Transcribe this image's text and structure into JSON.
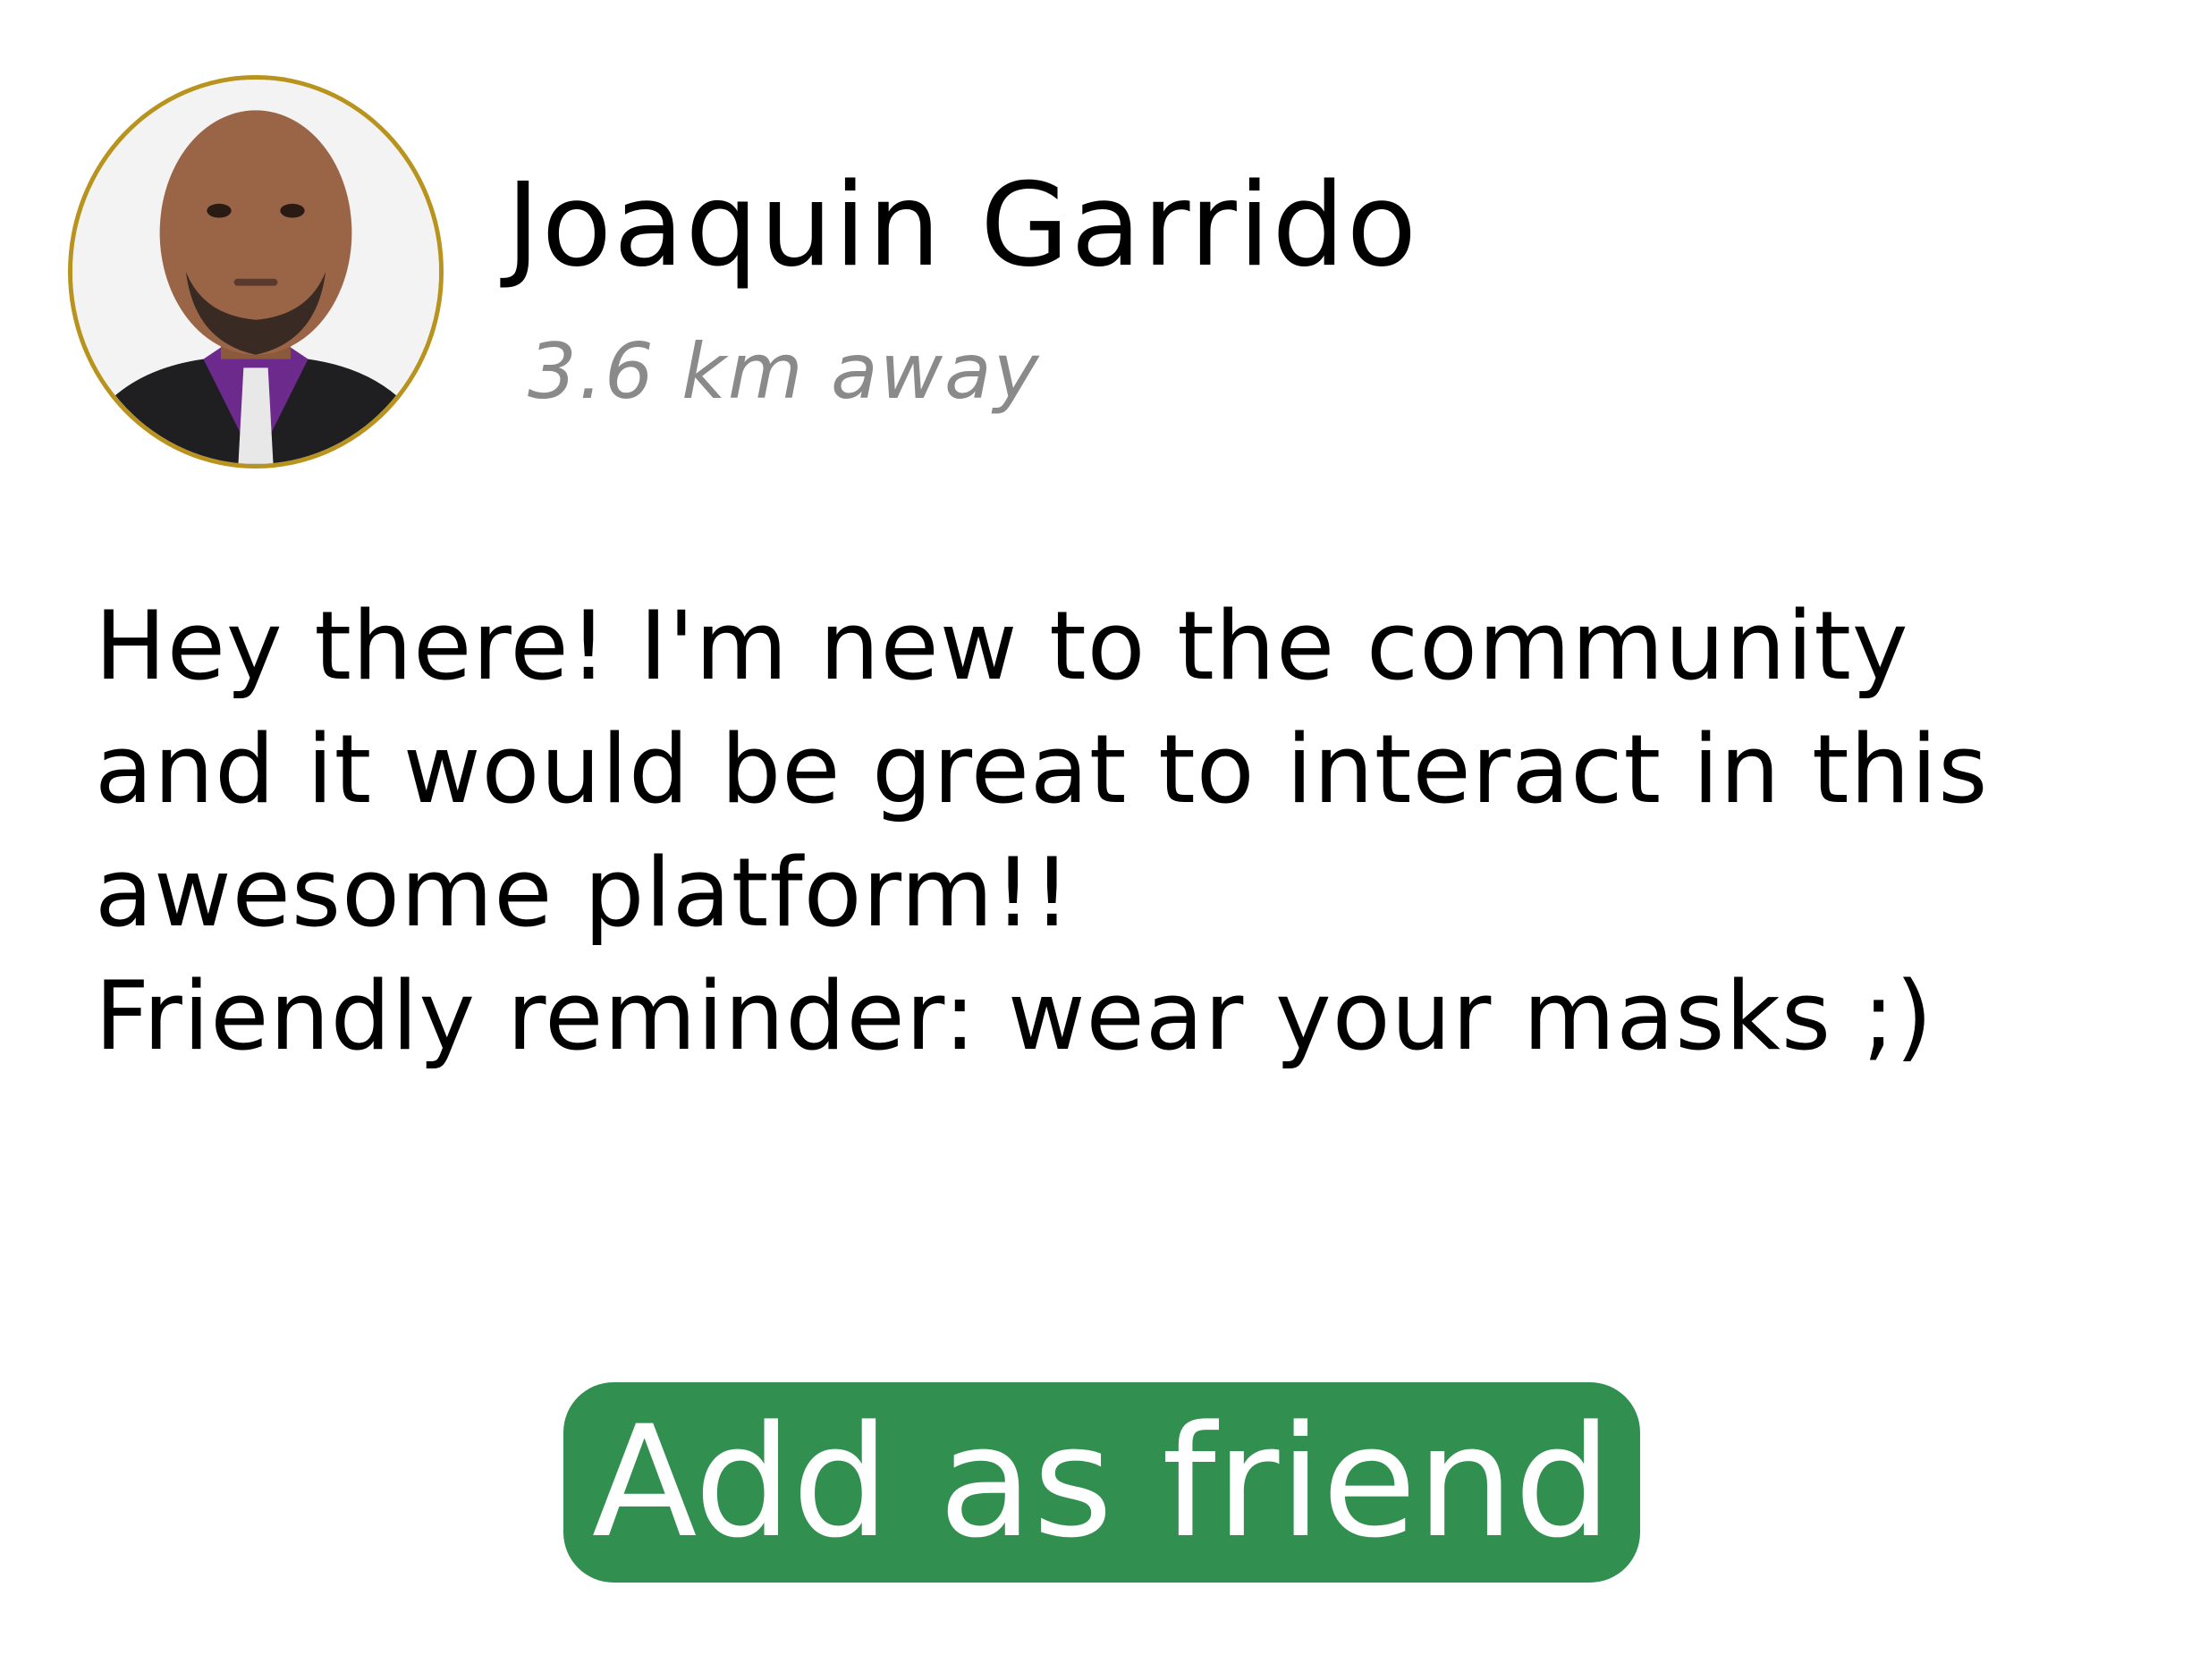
{
  "profile": {
    "name": "Joaquin Garrido",
    "distance": "3.6 km away",
    "bio_lines": [
      "Hey there! I'm new to the community",
      "and it would be great to interact in this",
      "awesome platform!!",
      "Friendly reminder: wear your masks ;)"
    ],
    "avatar_icon": "profile-photo"
  },
  "actions": {
    "add_friend_label": "Add as friend"
  },
  "colors": {
    "avatar_border": "#b8941f",
    "button_bg": "#319050",
    "button_text": "#ffffff",
    "distance_text": "#8a8a8a"
  }
}
